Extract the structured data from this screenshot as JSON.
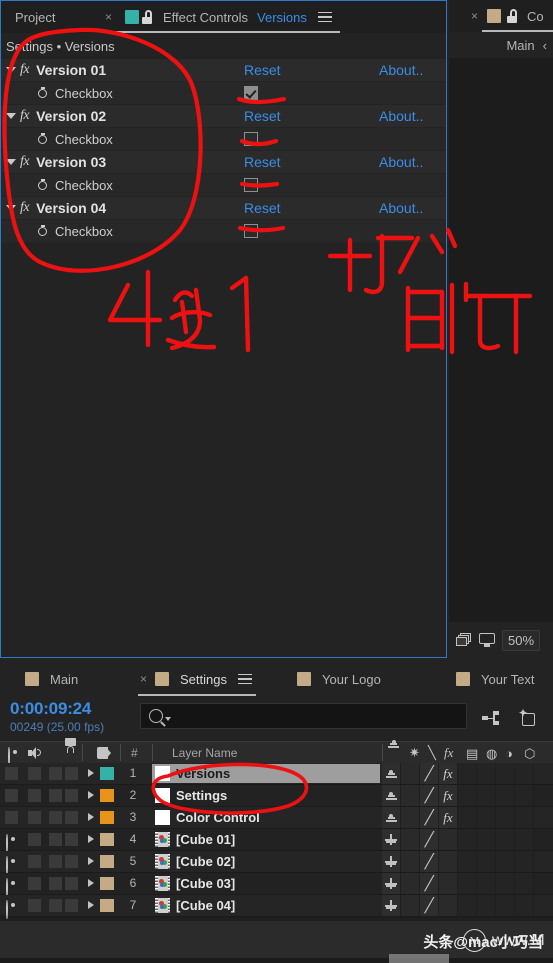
{
  "effect_controls": {
    "tabs": [
      {
        "label": "Project",
        "active": false,
        "has_close": true,
        "swatch": null
      },
      {
        "label": "Effect Controls",
        "active": true,
        "swatch": "#35b1a8",
        "secondary": "Versions"
      }
    ],
    "menu_icon": "hamburger-icon",
    "lock_icon": "unlock-icon",
    "breadcrumb": "Settings • Versions",
    "link_color": "#3a8ee6",
    "effects": [
      {
        "name": "Version 01",
        "reset": "Reset",
        "about": "About..",
        "param": "Checkbox",
        "checked": true
      },
      {
        "name": "Version 02",
        "reset": "Reset",
        "about": "About..",
        "param": "Checkbox",
        "checked": false
      },
      {
        "name": "Version 03",
        "reset": "Reset",
        "about": "About..",
        "param": "Checkbox",
        "checked": false
      },
      {
        "name": "Version 04",
        "reset": "Reset",
        "about": "About..",
        "param": "Checkbox",
        "checked": false
      }
    ]
  },
  "comp_panel": {
    "tab_label": "Co",
    "swatch": "#c2ab85",
    "nav_label": "Main",
    "chevron": "‹",
    "zoom": "50%",
    "renderer_icon": "renderer-icon",
    "monitor_icon": "monitor-icon"
  },
  "timeline": {
    "tabs": [
      {
        "label": "Main",
        "active": false,
        "swatch": "#c2ab85"
      },
      {
        "label": "Settings",
        "active": true,
        "swatch": "#c2ab85",
        "has_close": true
      },
      {
        "label": "Your Logo",
        "active": false,
        "swatch": "#c2ab85"
      },
      {
        "label": "Your Text",
        "active": false,
        "swatch": "#c2ab85"
      }
    ],
    "menu_icon": "hamburger-icon",
    "timecode": "0:00:09:24",
    "frame_info": "00249 (25.00 fps)",
    "timecode_color": "#3a8ee6",
    "search_placeholder": "",
    "search_value": "",
    "toolbar_icons": [
      "comp-flowchart-icon",
      "3d-renderer-icon"
    ],
    "columns": {
      "video_icon": "eye-icon",
      "audio_icon": "speaker-icon",
      "solo_icon": "solo-dot-icon",
      "lock_icon": "lock-icon",
      "label_icon": "label-tag-icon",
      "number": "#",
      "layer_name": "Layer Name"
    },
    "switch_headers": [
      "shy-icon",
      "collapse-icon",
      "quality-icon",
      "effects-fx-icon",
      "frameblend-icon",
      "motionblur-icon",
      "adjustment-icon",
      "3d-layer-icon"
    ],
    "layers": [
      {
        "num": "1",
        "name": "Versions",
        "label_color": "#35b1a8",
        "icon": "solid-icon",
        "selected": true,
        "visible": false,
        "shy": true,
        "quality": true,
        "fx": true
      },
      {
        "num": "2",
        "name": "Settings",
        "label_color": "#e8941a",
        "icon": "solid-icon",
        "selected": false,
        "visible": false,
        "shy": true,
        "quality": true,
        "fx": true
      },
      {
        "num": "3",
        "name": "Color Control",
        "label_color": "#e8941a",
        "icon": "solid-icon",
        "selected": false,
        "visible": false,
        "shy": true,
        "quality": true,
        "fx": true
      },
      {
        "num": "4",
        "name": "[Cube 01]",
        "label_color": "#c2ab85",
        "icon": "footage-icon",
        "selected": false,
        "visible": true,
        "shy": false,
        "quality": true,
        "fx": false
      },
      {
        "num": "5",
        "name": "[Cube 02]",
        "label_color": "#c2ab85",
        "icon": "footage-icon",
        "selected": false,
        "visible": true,
        "shy": false,
        "quality": true,
        "fx": false
      },
      {
        "num": "6",
        "name": "[Cube 03]",
        "label_color": "#c2ab85",
        "icon": "footage-icon",
        "selected": false,
        "visible": true,
        "shy": false,
        "quality": true,
        "fx": false
      },
      {
        "num": "7",
        "name": "[Cube 04]",
        "label_color": "#c2ab85",
        "icon": "footage-icon",
        "selected": false,
        "visible": true,
        "shy": false,
        "quality": true,
        "fx": false
      }
    ]
  },
  "annotations": {
    "color": "#ee1111",
    "note_choose": "4选1",
    "note_check": "打✓",
    "note_done": "即可"
  },
  "watermark": {
    "logo_letter": "M",
    "url": "www.M",
    "overlay": "头条@mac小巧当"
  }
}
